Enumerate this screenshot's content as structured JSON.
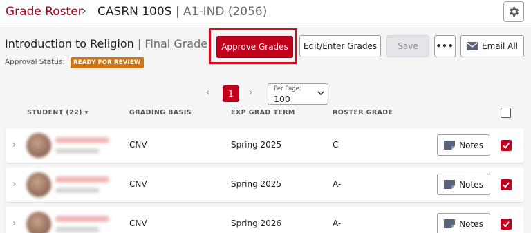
{
  "header": {
    "breadcrumb_root": "Grade Roster",
    "breadcrumb_sep": "›",
    "course_code": "CASRN 100S",
    "course_sep": " | ",
    "course_section": "A1-IND (2056)"
  },
  "course": {
    "title": "Introduction to Religion",
    "sep": " | ",
    "grade_type": "Final Grade",
    "approval_label": "Approval Status:",
    "status_badge": "READY FOR REVIEW"
  },
  "toolbar": {
    "approve_label": "Approve Grades",
    "edit_label": "Edit/Enter Grades",
    "save_label": "Save",
    "more_label": "•••",
    "email_label": "Email All"
  },
  "pagination": {
    "prev": "‹",
    "current_page": "1",
    "next": "›",
    "per_page_label": "Per Page:",
    "per_page_value": "100"
  },
  "table": {
    "headers": {
      "student": "STUDENT (22) ▾",
      "grading_basis": "GRADING BASIS",
      "exp_grad_term": "EXP GRAD TERM",
      "roster_grade": "ROSTER GRADE"
    },
    "rows": [
      {
        "grading_basis": "CNV",
        "exp_grad_term": "Spring 2025",
        "roster_grade": "C",
        "notes_label": "Notes",
        "checked": true
      },
      {
        "grading_basis": "CNV",
        "exp_grad_term": "Spring 2025",
        "roster_grade": "A-",
        "notes_label": "Notes",
        "checked": true
      },
      {
        "grading_basis": "CNV",
        "exp_grad_term": "Spring 2026",
        "roster_grade": "A-",
        "notes_label": "Notes",
        "checked": true
      }
    ]
  },
  "colors": {
    "brand_red": "#c1001d",
    "badge_orange": "#c9761a",
    "highlight_red": "#d0101c"
  }
}
